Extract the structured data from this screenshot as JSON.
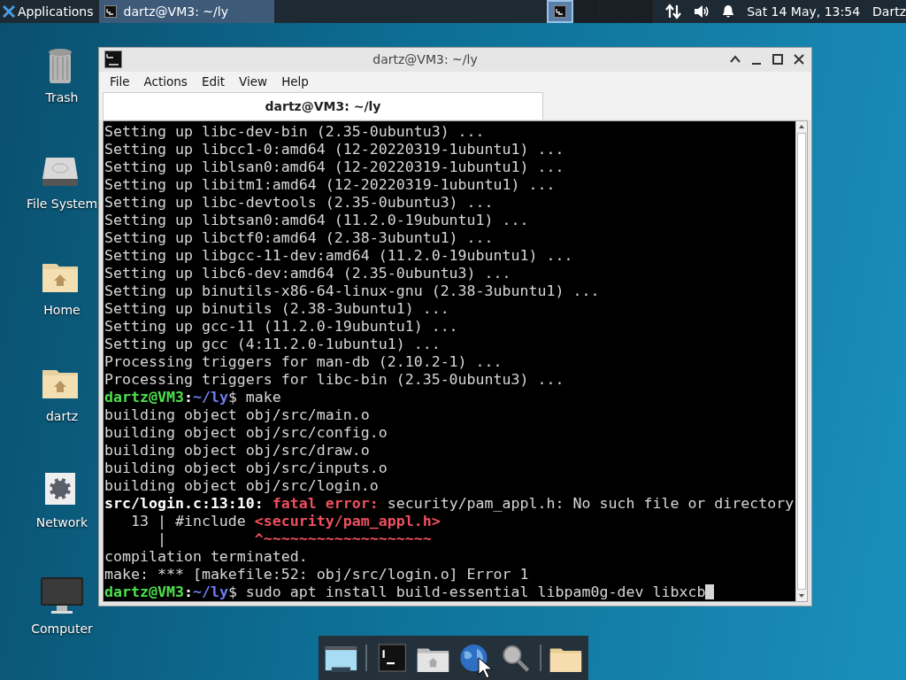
{
  "top_panel": {
    "menu_label": "Applications",
    "tasks": [
      {
        "title": "dartz@VM3: ~/ly",
        "selected": true
      }
    ],
    "workspaces": [
      {
        "selected": true
      },
      {
        "selected": false
      },
      {
        "selected": false
      },
      {
        "selected": false
      }
    ],
    "clock": "Sat 14 May, 13:54",
    "user": "Dartz"
  },
  "desktop_icons": [
    {
      "label": "Trash",
      "kind": "trash"
    },
    {
      "label": "File System",
      "kind": "drive"
    },
    {
      "label": "Home",
      "kind": "home"
    },
    {
      "label": "dartz",
      "kind": "home"
    },
    {
      "label": "Network",
      "kind": "network"
    },
    {
      "label": "Computer",
      "kind": "computer"
    }
  ],
  "window": {
    "title": "dartz@VM3: ~/ly",
    "menu": [
      "File",
      "Actions",
      "Edit",
      "View",
      "Help"
    ],
    "tabs": [
      {
        "label": "dartz@VM3: ~/ly",
        "selected": true
      }
    ],
    "terminal_lines": [
      [
        {
          "kind": "plain",
          "text": "Setting up libc-dev-bin (2.35-0ubuntu3) ..."
        }
      ],
      [
        {
          "kind": "plain",
          "text": "Setting up libcc1-0:amd64 (12-20220319-1ubuntu1) ..."
        }
      ],
      [
        {
          "kind": "plain",
          "text": "Setting up liblsan0:amd64 (12-20220319-1ubuntu1) ..."
        }
      ],
      [
        {
          "kind": "plain",
          "text": "Setting up libitm1:amd64 (12-20220319-1ubuntu1) ..."
        }
      ],
      [
        {
          "kind": "plain",
          "text": "Setting up libc-devtools (2.35-0ubuntu3) ..."
        }
      ],
      [
        {
          "kind": "plain",
          "text": "Setting up libtsan0:amd64 (11.2.0-19ubuntu1) ..."
        }
      ],
      [
        {
          "kind": "plain",
          "text": "Setting up libctf0:amd64 (2.38-3ubuntu1) ..."
        }
      ],
      [
        {
          "kind": "plain",
          "text": "Setting up libgcc-11-dev:amd64 (11.2.0-19ubuntu1) ..."
        }
      ],
      [
        {
          "kind": "plain",
          "text": "Setting up libc6-dev:amd64 (2.35-0ubuntu3) ..."
        }
      ],
      [
        {
          "kind": "plain",
          "text": "Setting up binutils-x86-64-linux-gnu (2.38-3ubuntu1) ..."
        }
      ],
      [
        {
          "kind": "plain",
          "text": "Setting up binutils (2.38-3ubuntu1) ..."
        }
      ],
      [
        {
          "kind": "plain",
          "text": "Setting up gcc-11 (11.2.0-19ubuntu1) ..."
        }
      ],
      [
        {
          "kind": "plain",
          "text": "Setting up gcc (4:11.2.0-1ubuntu1) ..."
        }
      ],
      [
        {
          "kind": "plain",
          "text": "Processing triggers for man-db (2.10.2-1) ..."
        }
      ],
      [
        {
          "kind": "plain",
          "text": "Processing triggers for libc-bin (2.35-0ubuntu3) ..."
        }
      ],
      [
        {
          "kind": "user",
          "text": "dartz@VM3"
        },
        {
          "kind": "bold",
          "text": ":"
        },
        {
          "kind": "path",
          "text": "~/ly"
        },
        {
          "kind": "plain",
          "text": "$ make"
        }
      ],
      [
        {
          "kind": "plain",
          "text": "building object obj/src/main.o"
        }
      ],
      [
        {
          "kind": "plain",
          "text": "building object obj/src/config.o"
        }
      ],
      [
        {
          "kind": "plain",
          "text": "building object obj/src/draw.o"
        }
      ],
      [
        {
          "kind": "plain",
          "text": "building object obj/src/inputs.o"
        }
      ],
      [
        {
          "kind": "plain",
          "text": "building object obj/src/login.o"
        }
      ],
      [
        {
          "kind": "bold",
          "text": "src/login.c:13:10: "
        },
        {
          "kind": "error",
          "text": "fatal error:"
        },
        {
          "kind": "plain",
          "text": " security/pam_appl.h: No such file or directory"
        }
      ],
      [
        {
          "kind": "plain",
          "text": "   13 | #include "
        },
        {
          "kind": "error",
          "text": "<security/pam_appl.h>"
        }
      ],
      [
        {
          "kind": "plain",
          "text": "      |          "
        },
        {
          "kind": "error",
          "text": "^~~~~~~~~~~~~~~~~~~~"
        }
      ],
      [
        {
          "kind": "plain",
          "text": "compilation terminated."
        }
      ],
      [
        {
          "kind": "plain",
          "text": "make: *** [makefile:52: obj/src/login.o] Error 1"
        }
      ],
      [
        {
          "kind": "user",
          "text": "dartz@VM3"
        },
        {
          "kind": "bold",
          "text": ":"
        },
        {
          "kind": "path",
          "text": "~/ly"
        },
        {
          "kind": "plain",
          "text": "$ sudo apt install build-essential libpam0g-dev libxcb"
        },
        {
          "kind": "cursor"
        }
      ]
    ]
  },
  "dock": [
    {
      "kind": "show-desktop"
    },
    {
      "kind": "separator"
    },
    {
      "kind": "terminal"
    },
    {
      "kind": "home-folder"
    },
    {
      "kind": "globe"
    },
    {
      "kind": "search"
    },
    {
      "kind": "separator"
    },
    {
      "kind": "folder"
    }
  ]
}
